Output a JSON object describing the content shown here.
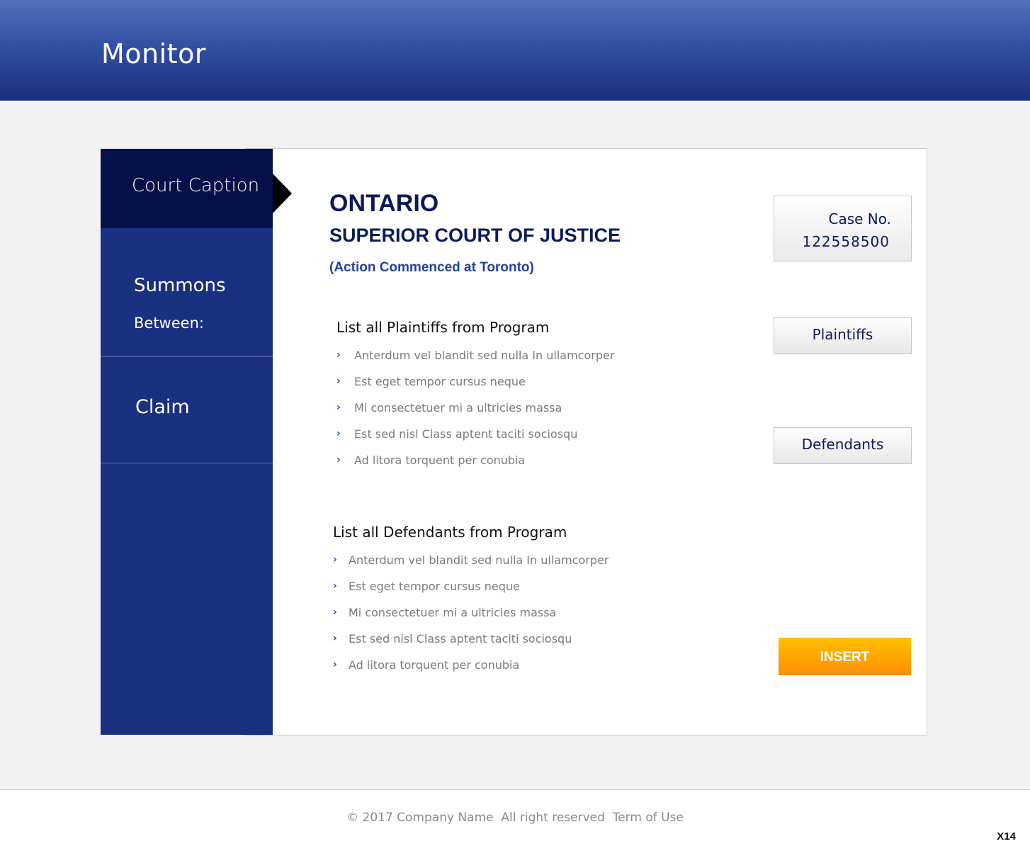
{
  "header": {
    "title": "Monitor"
  },
  "sidebar": {
    "items": [
      {
        "label": "Court Caption",
        "active": true
      },
      {
        "label": "Summons",
        "sublabel": "Between:"
      },
      {
        "label": "Claim"
      }
    ]
  },
  "caption": {
    "province": "ONTARIO",
    "court": "SUPERIOR COURT OF JUSTICE",
    "commenced": "(Action Commenced at Toronto)"
  },
  "case": {
    "label": "Case No.",
    "number": "122558500"
  },
  "buttons": {
    "plaintiffs": "Plaintiffs",
    "defendants": "Defendants",
    "insert": "INSERT"
  },
  "plaintiffs": {
    "heading": "List all Plaintiffs from Program",
    "items": [
      "Anterdum vel blandit sed nulla In ullamcorper",
      "Est eget tempor cursus neque",
      "Mi consectetuer mi a ultricies massa",
      "Est sed nisl Class aptent taciti sociosqu",
      "Ad litora torquent per conubia"
    ]
  },
  "defendants": {
    "heading": "List all Defendants from Program",
    "items": [
      "Anterdum vel blandit sed nulla In ullamcorper",
      "Est eget tempor cursus neque",
      "Mi consectetuer mi a ultricies massa",
      "Est sed nisl Class aptent taciti sociosqu",
      "Ad litora torquent per conubia"
    ]
  },
  "footer": {
    "copyright": "© 2017 Company Name  All right reserved  Term of Use",
    "page_code": "X14"
  },
  "colors": {
    "header_top": "#5470bd",
    "header_bottom": "#1c2f7e",
    "sidebar": "#1a3080",
    "sidebar_active": "#050f48",
    "title_text": "#0c1a5a",
    "insert_top": "#ffbe00",
    "insert_bottom": "#ff8f05"
  },
  "icons": {
    "list_bullet": "chevron-right-icon",
    "active_pointer": "triangle-right-icon"
  }
}
